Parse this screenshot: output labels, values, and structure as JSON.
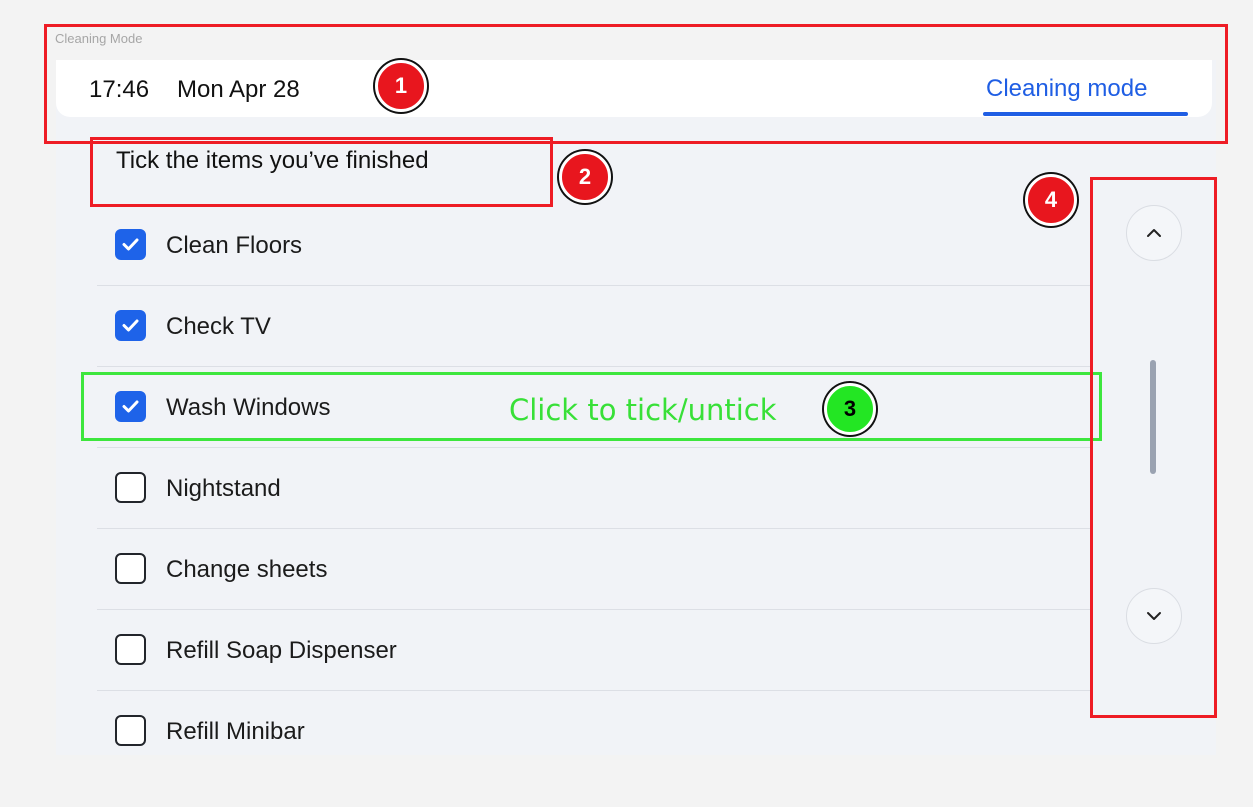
{
  "frame": {
    "label": "Cleaning Mode"
  },
  "header": {
    "time": "17:46",
    "date": "Mon Apr 28",
    "mode_tab": "Cleaning mode"
  },
  "instruction": "Tick the items you’ve finished",
  "checklist": [
    {
      "label": "Clean Floors",
      "checked": true
    },
    {
      "label": "Check TV",
      "checked": true
    },
    {
      "label": "Wash Windows",
      "checked": true
    },
    {
      "label": "Nightstand",
      "checked": false
    },
    {
      "label": "Change sheets",
      "checked": false
    },
    {
      "label": "Refill Soap Dispenser",
      "checked": false
    },
    {
      "label": "Refill Minibar",
      "checked": false
    }
  ],
  "scroll": {
    "up_icon": "chevron-up-icon",
    "down_icon": "chevron-down-icon"
  },
  "annotations": {
    "badges": [
      "1",
      "2",
      "3",
      "4"
    ],
    "hint": "Click to tick/untick"
  },
  "colors": {
    "accent": "#1f5ee4",
    "checkbox_checked": "#1e63e9",
    "annotation_red": "#ee1c25",
    "annotation_green": "#3de63d"
  }
}
